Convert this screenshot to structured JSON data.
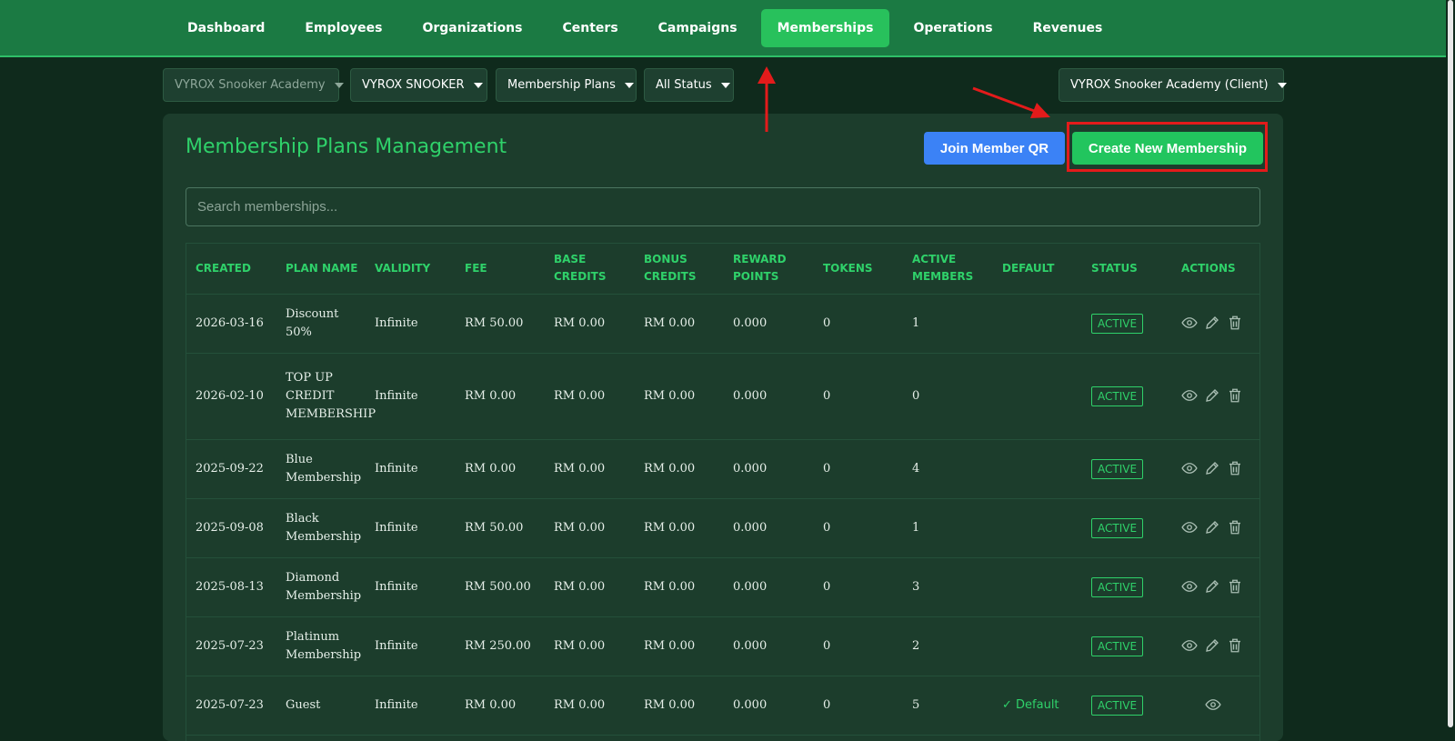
{
  "nav": {
    "items": [
      {
        "label": "Dashboard",
        "active": false
      },
      {
        "label": "Employees",
        "active": false
      },
      {
        "label": "Organizations",
        "active": false
      },
      {
        "label": "Centers",
        "active": false
      },
      {
        "label": "Campaigns",
        "active": false
      },
      {
        "label": "Memberships",
        "active": true
      },
      {
        "label": "Operations",
        "active": false
      },
      {
        "label": "Revenues",
        "active": false
      }
    ]
  },
  "filters": {
    "organization": "VYROX Snooker Academy",
    "center": "VYROX SNOOKER",
    "view": "Membership Plans",
    "status": "All Status",
    "client": "VYROX Snooker Academy (Client)"
  },
  "page": {
    "title": "Membership Plans Management",
    "join_qr_label": "Join Member QR",
    "create_label": "Create New Membership",
    "search_placeholder": "Search memberships..."
  },
  "table": {
    "headers": [
      "CREATED",
      "PLAN NAME",
      "VALIDITY",
      "FEE",
      "BASE CREDITS",
      "BONUS CREDITS",
      "REWARD POINTS",
      "TOKENS",
      "ACTIVE MEMBERS",
      "DEFAULT",
      "STATUS",
      "ACTIONS"
    ],
    "rows": [
      {
        "created": "2026-03-16",
        "plan_name": "Discount 50%",
        "validity": "Infinite",
        "fee": "RM 50.00",
        "base_credits": "RM 0.00",
        "bonus_credits": "RM 0.00",
        "reward_points": "0.000",
        "tokens": "0",
        "active_members": "1",
        "default": "",
        "status": "ACTIVE",
        "editable": true
      },
      {
        "created": "2026-02-10",
        "plan_name": "TOP UP CREDIT MEMBERSHIP",
        "validity": "Infinite",
        "fee": "RM 0.00",
        "base_credits": "RM 0.00",
        "bonus_credits": "RM 0.00",
        "reward_points": "0.000",
        "tokens": "0",
        "active_members": "0",
        "default": "",
        "status": "ACTIVE",
        "editable": true
      },
      {
        "created": "2025-09-22",
        "plan_name": "Blue Membership",
        "validity": "Infinite",
        "fee": "RM 0.00",
        "base_credits": "RM 0.00",
        "bonus_credits": "RM 0.00",
        "reward_points": "0.000",
        "tokens": "0",
        "active_members": "4",
        "default": "",
        "status": "ACTIVE",
        "editable": true
      },
      {
        "created": "2025-09-08",
        "plan_name": "Black Membership",
        "validity": "Infinite",
        "fee": "RM 50.00",
        "base_credits": "RM 0.00",
        "bonus_credits": "RM 0.00",
        "reward_points": "0.000",
        "tokens": "0",
        "active_members": "1",
        "default": "",
        "status": "ACTIVE",
        "editable": true
      },
      {
        "created": "2025-08-13",
        "plan_name": "Diamond Membership",
        "validity": "Infinite",
        "fee": "RM 500.00",
        "base_credits": "RM 0.00",
        "bonus_credits": "RM 0.00",
        "reward_points": "0.000",
        "tokens": "0",
        "active_members": "3",
        "default": "",
        "status": "ACTIVE",
        "editable": true
      },
      {
        "created": "2025-07-23",
        "plan_name": "Platinum Membership",
        "validity": "Infinite",
        "fee": "RM 250.00",
        "base_credits": "RM 0.00",
        "bonus_credits": "RM 0.00",
        "reward_points": "0.000",
        "tokens": "0",
        "active_members": "2",
        "default": "",
        "status": "ACTIVE",
        "editable": true
      },
      {
        "created": "2025-07-23",
        "plan_name": "Guest",
        "validity": "Infinite",
        "fee": "RM 0.00",
        "base_credits": "RM 0.00",
        "bonus_credits": "RM 0.00",
        "reward_points": "0.000",
        "tokens": "0",
        "active_members": "5",
        "default": "✓ Default",
        "status": "ACTIVE",
        "editable": false
      }
    ]
  },
  "colors": {
    "nav_bg": "#1b7a43",
    "nav_active": "#28c15c",
    "accent_green": "#2fd16a",
    "button_blue": "#3b82f6",
    "button_green": "#22c55e",
    "annotation_red": "#e31b1b"
  },
  "icons": {
    "view": "eye-icon",
    "edit": "pencil-icon",
    "delete": "trash-icon",
    "dropdown": "caret-down-icon"
  }
}
